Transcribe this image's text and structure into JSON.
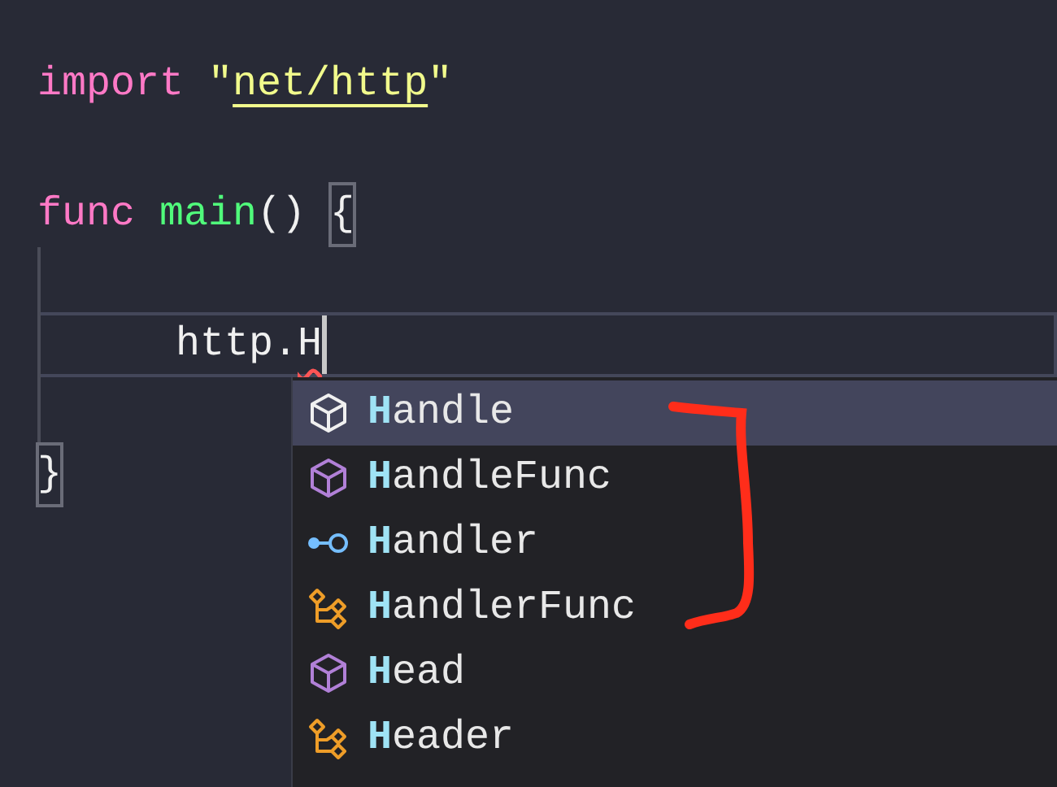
{
  "editor": {
    "lines": [
      {
        "kind": "code",
        "tokens": [
          {
            "text": "import ",
            "kind": "keyword"
          },
          {
            "text": "\"",
            "kind": "string"
          },
          {
            "text": "net/http",
            "kind": "link"
          },
          {
            "text": "\"",
            "kind": "string"
          }
        ]
      },
      {
        "kind": "blank"
      },
      {
        "kind": "code",
        "tokens": [
          {
            "text": "func ",
            "kind": "keyword"
          },
          {
            "text": "main",
            "kind": "function"
          },
          {
            "text": "() ",
            "kind": "plain"
          },
          {
            "text": "{",
            "kind": "bracket"
          }
        ]
      },
      {
        "kind": "blank"
      },
      {
        "kind": "current",
        "tokens": [
          {
            "text": "    http.",
            "kind": "plain"
          },
          {
            "text": "H",
            "kind": "error"
          }
        ]
      },
      {
        "kind": "blank"
      },
      {
        "kind": "code",
        "tokens": [
          {
            "text": "}",
            "kind": "bracket"
          }
        ]
      }
    ]
  },
  "suggestions": [
    {
      "match": "H",
      "rest": "andle",
      "kind": "cube",
      "selected": true
    },
    {
      "match": "H",
      "rest": "andleFunc",
      "kind": "cube",
      "selected": false
    },
    {
      "match": "H",
      "rest": "andler",
      "kind": "interface",
      "selected": false
    },
    {
      "match": "H",
      "rest": "andlerFunc",
      "kind": "tree",
      "selected": false
    },
    {
      "match": "H",
      "rest": "ead",
      "kind": "cube",
      "selected": false
    },
    {
      "match": "H",
      "rest": "eader",
      "kind": "tree",
      "selected": false
    }
  ]
}
